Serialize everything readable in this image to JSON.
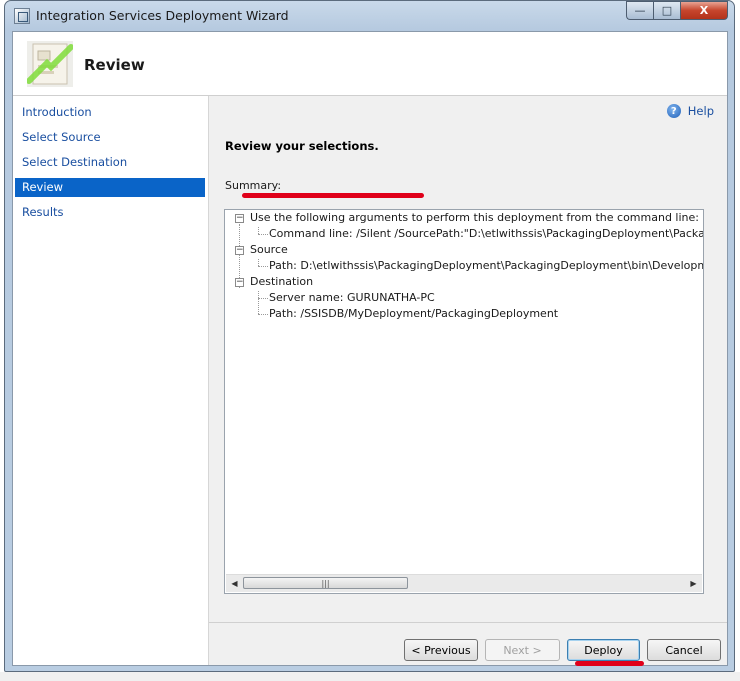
{
  "window": {
    "title": "Integration Services Deployment Wizard"
  },
  "header": {
    "title": "Review"
  },
  "nav": {
    "items": [
      {
        "label": "Introduction"
      },
      {
        "label": "Select Source"
      },
      {
        "label": "Select Destination"
      },
      {
        "label": "Review"
      },
      {
        "label": "Results"
      }
    ],
    "active": "Review"
  },
  "help": {
    "label": "Help"
  },
  "review": {
    "heading": "Review your selections.",
    "summary_label": "Summary:"
  },
  "tree": {
    "cmd_parent": "Use the following arguments to perform this deployment from the command line:",
    "cmd_child": "Command line: /Silent /SourcePath:\"D:\\etlwithssis\\PackagingDeployment\\PackagingDeployment",
    "source_parent": "Source",
    "source_child": "Path: D:\\etlwithssis\\PackagingDeployment\\PackagingDeployment\\bin\\Development\\Pack",
    "dest_parent": "Destination",
    "dest_server": "Server name: GURUNATHA-PC",
    "dest_path": "Path: /SSISDB/MyDeployment/PackagingDeployment",
    "expander_glyph": "−",
    "scroll_grip": "|||"
  },
  "buttons": {
    "previous": "< Previous",
    "next": "Next >",
    "deploy": "Deploy",
    "cancel": "Cancel"
  },
  "titlebar_buttons": {
    "minimize": "—",
    "maximize": "□",
    "close": "X"
  },
  "colors": {
    "accent": "#0a64c8",
    "annotation": "#e0001a",
    "link": "#1a4fa0"
  }
}
